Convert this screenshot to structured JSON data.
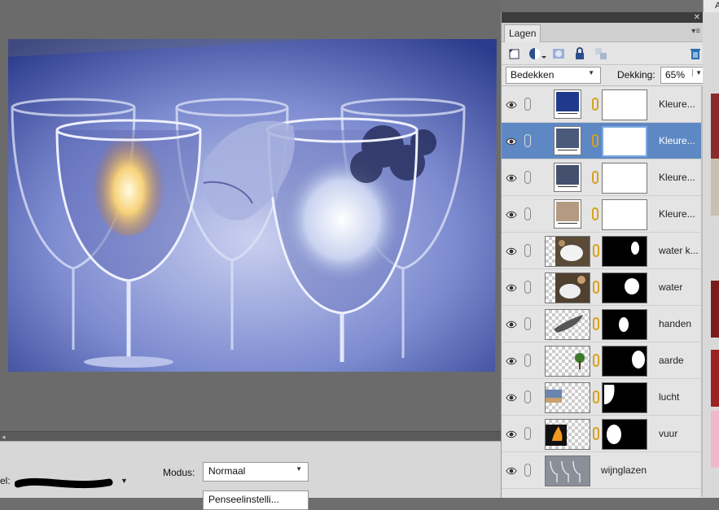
{
  "canvas": {
    "image": "wine glasses with fire, water, hand and tree composite tinted blue"
  },
  "toolbar": {
    "brush_label": "el:",
    "modus_label": "Modus:",
    "modus_value": "Normaal",
    "second_button": "Penseelinstelli..."
  },
  "panel": {
    "tab_label": "Lagen",
    "blend_mode": "Bedekken",
    "opacity_label": "Dekking:",
    "opacity_value": "65%",
    "layers": [
      {
        "name": "Kleure...",
        "type": "adjustment",
        "swatch": "#1f3a8c",
        "selected": false
      },
      {
        "name": "Kleure...",
        "type": "adjustment",
        "swatch": "#4c5a7a",
        "selected": true
      },
      {
        "name": "Kleure...",
        "type": "adjustment",
        "swatch": "#44506e",
        "selected": false
      },
      {
        "name": "Kleure...",
        "type": "adjustment",
        "swatch": "#b39a80",
        "selected": false
      },
      {
        "name": "water k...",
        "type": "image",
        "selected": false
      },
      {
        "name": "water",
        "type": "image",
        "selected": false
      },
      {
        "name": "handen",
        "type": "image",
        "selected": false
      },
      {
        "name": "aarde",
        "type": "image",
        "selected": false
      },
      {
        "name": "lucht",
        "type": "image",
        "selected": false
      },
      {
        "name": "vuur",
        "type": "image",
        "selected": false
      },
      {
        "name": "wijnglazen",
        "type": "background",
        "selected": false
      }
    ]
  },
  "right_strip": {
    "label": "A"
  },
  "colors": {
    "selection": "#5e88c4",
    "link": "#d9a020",
    "photo_tint": "#3d4f9a"
  }
}
